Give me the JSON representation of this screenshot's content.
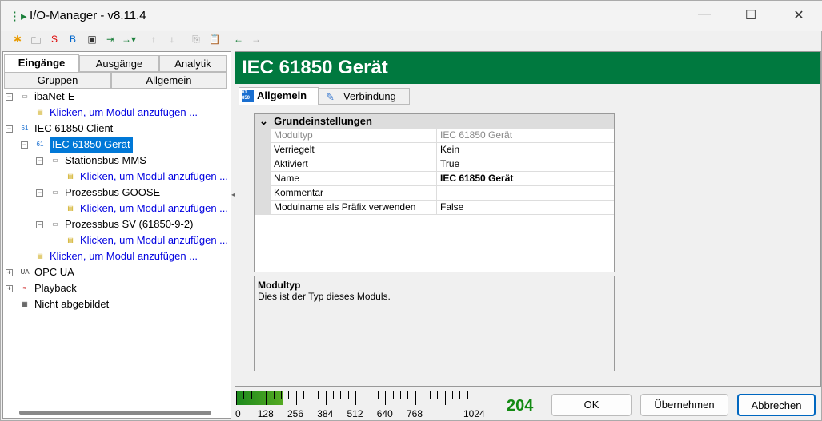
{
  "window": {
    "title": "I/O-Manager - v8.11.4"
  },
  "left_tabs": {
    "row1": [
      "Eingänge",
      "Ausgänge",
      "Analytik"
    ],
    "row2": [
      "Gruppen",
      "Allgemein"
    ]
  },
  "tree": [
    {
      "label": "ibaNet-E",
      "level": 0,
      "exp": "−",
      "icon": "network-icon",
      "link": false
    },
    {
      "label": "Klicken, um Modul anzufügen ...",
      "level": 1,
      "icon": "add-module-icon",
      "link": true
    },
    {
      "label": "IEC 61850 Client",
      "level": 0,
      "exp": "−",
      "icon": "iec61850-icon",
      "link": false
    },
    {
      "label": "IEC 61850 Gerät",
      "level": 1,
      "exp": "−",
      "icon": "iec61850-icon",
      "selected": true
    },
    {
      "label": "Stationsbus MMS",
      "level": 2,
      "exp": "−",
      "icon": "network-icon"
    },
    {
      "label": "Klicken, um Modul anzufügen ...",
      "level": 3,
      "icon": "add-module-icon",
      "link": true
    },
    {
      "label": "Prozessbus GOOSE",
      "level": 2,
      "exp": "−",
      "icon": "network-icon"
    },
    {
      "label": "Klicken, um Modul anzufügen ...",
      "level": 3,
      "icon": "add-module-icon",
      "link": true
    },
    {
      "label": "Prozessbus SV (61850-9-2)",
      "level": 2,
      "exp": "−",
      "icon": "network-icon"
    },
    {
      "label": "Klicken, um Modul anzufügen ...",
      "level": 3,
      "icon": "add-module-icon",
      "link": true
    },
    {
      "label": "Klicken, um Modul anzufügen ...",
      "level": 1,
      "icon": "add-module-icon",
      "link": true
    },
    {
      "label": "OPC UA",
      "level": 0,
      "exp": "+",
      "icon": "opcua-icon"
    },
    {
      "label": "Playback",
      "level": 0,
      "exp": "+",
      "icon": "playback-icon"
    },
    {
      "label": "Nicht abgebildet",
      "level": 0,
      "icon": "unmapped-icon"
    }
  ],
  "header": {
    "title": "IEC 61850 Gerät"
  },
  "right_tabs": [
    "Allgemein",
    "Verbindung"
  ],
  "grid": {
    "category": "Grundeinstellungen",
    "rows": [
      {
        "key": "Modultyp",
        "value": "IEC 61850 Gerät",
        "readonly": true
      },
      {
        "key": "Verriegelt",
        "value": "Kein"
      },
      {
        "key": "Aktiviert",
        "value": "True"
      },
      {
        "key": "Name",
        "value": "IEC 61850 Gerät",
        "bold": true
      },
      {
        "key": "Kommentar",
        "value": ""
      },
      {
        "key": "Modulname als Präfix verwenden",
        "value": "False"
      }
    ]
  },
  "description": {
    "title": "Modultyp",
    "text": "Dies ist der Typ dieses Moduls."
  },
  "meter": {
    "value": 204,
    "max": 1024,
    "labels": [
      "0",
      "128",
      "256",
      "384",
      "512",
      "640",
      "768",
      "1024"
    ],
    "value_text": "204",
    "color": "#138a13"
  },
  "buttons": {
    "ok": "OK",
    "apply": "Übernehmen",
    "cancel": "Abbrechen"
  }
}
